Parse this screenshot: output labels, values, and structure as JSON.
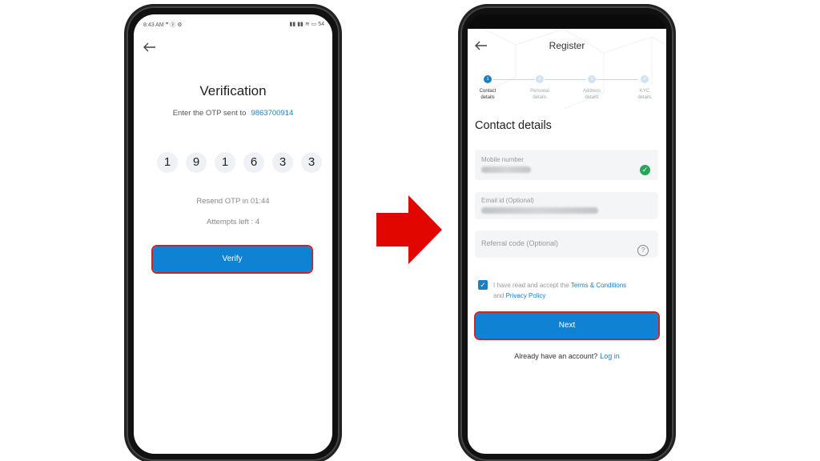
{
  "left_screen": {
    "status_time": "8:43 AM",
    "status_icons_left": "❞ ⓟ ⚙",
    "status_icons_right": "▮▮ ▮▮ ≋ ▭ 54",
    "title": "Verification",
    "otp_prompt": "Enter the OTP sent to",
    "phone_number": "9863700914",
    "otp_digits": [
      "1",
      "9",
      "1",
      "6",
      "3",
      "3"
    ],
    "resend_text": "Resend OTP in  01:44",
    "attempts_text": "Attempts left : 4",
    "verify_label": "Verify"
  },
  "right_screen": {
    "header_title": "Register",
    "steps": [
      {
        "num": "1",
        "label_line1": "Contact",
        "label_line2": "details"
      },
      {
        "num": "2",
        "label_line1": "Personal",
        "label_line2": "details"
      },
      {
        "num": "3",
        "label_line1": "Address",
        "label_line2": "details"
      },
      {
        "num": "4",
        "label_line1": "KYC",
        "label_line2": "details"
      }
    ],
    "section_title": "Contact details",
    "mobile_label": "Mobile number",
    "email_label": "Email id (Optional)",
    "referral_placeholder": "Referral code (Optional)",
    "terms_prefix": "I have read and accept the",
    "terms_link": "Terms & Conditions",
    "terms_and": "and",
    "privacy_link": "Privacy Policy",
    "next_label": "Next",
    "login_prompt": "Already have an account?",
    "login_link": "Log in"
  },
  "colors": {
    "accent": "#1b7fc3",
    "button": "#1082d4",
    "highlight_outline": "#c62828",
    "arrow": "#e10600",
    "success": "#26a65b"
  },
  "icons": [
    "back-arrow-icon",
    "checkmark-icon",
    "help-icon",
    "checkbox-checked-icon",
    "right-arrow-icon"
  ]
}
